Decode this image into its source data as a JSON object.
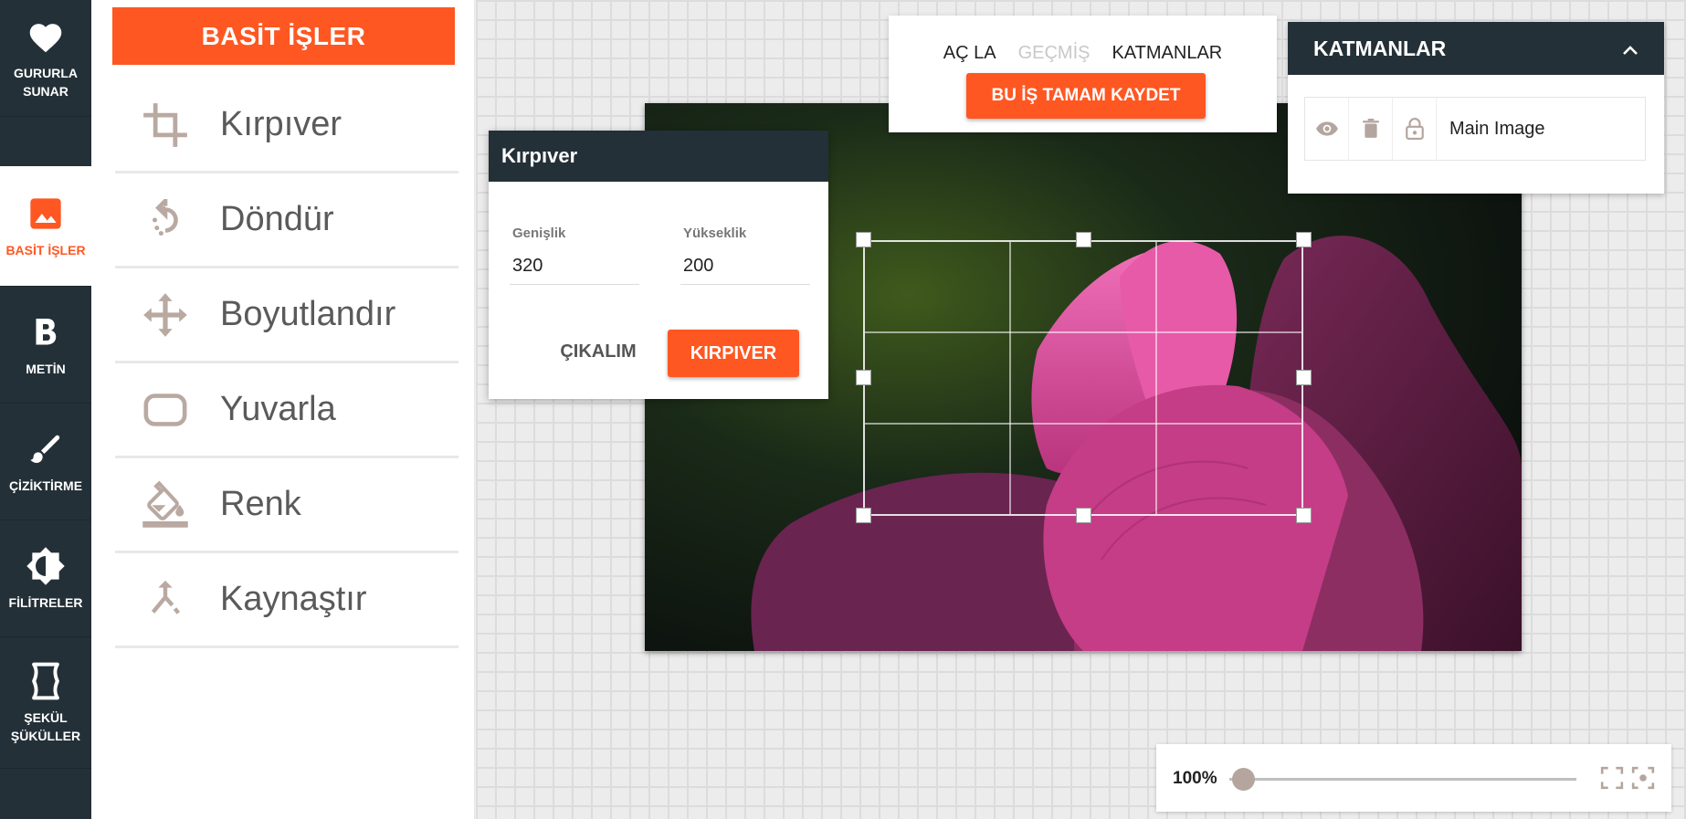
{
  "rail": {
    "items": [
      {
        "label_line1": "GURURLA",
        "label_line2": "SUNAR",
        "icon": "heart-icon"
      },
      {
        "label_line1": "BASİT İŞLER",
        "label_line2": "",
        "icon": "image-icon",
        "active": true
      },
      {
        "label_line1": "METİN",
        "label_line2": "",
        "icon": "bold-b-icon"
      },
      {
        "label_line1": "ÇİZİKTİRME",
        "label_line2": "",
        "icon": "brush-icon"
      },
      {
        "label_line1": "FİLİTRELER",
        "label_line2": "",
        "icon": "brightness-icon"
      },
      {
        "label_line1": "ŞEKÜL",
        "label_line2": "ŞÜKÜLLER",
        "icon": "shape-icon"
      }
    ]
  },
  "tools": {
    "header": "BASİT İŞLER",
    "items": [
      {
        "label": "Kırpıver",
        "icon": "crop-icon"
      },
      {
        "label": "Döndür",
        "icon": "rotate-icon"
      },
      {
        "label": "Boyutlandır",
        "icon": "resize-arrows-icon"
      },
      {
        "label": "Yuvarla",
        "icon": "rounded-rect-icon"
      },
      {
        "label": "Renk",
        "icon": "paint-bucket-icon"
      },
      {
        "label": "Kaynaştır",
        "icon": "merge-icon"
      }
    ]
  },
  "topmenu": {
    "tabs": [
      {
        "label": "AÇ LA",
        "disabled": false
      },
      {
        "label": "GEÇMİŞ",
        "disabled": true
      },
      {
        "label": "KATMANLAR",
        "disabled": false
      }
    ],
    "save_label": "BU İŞ TAMAM KAYDET"
  },
  "layers": {
    "title": "KATMANLAR",
    "row": {
      "name": "Main Image"
    }
  },
  "crop_dialog": {
    "title": "Kırpıver",
    "width_label": "Genişlik",
    "width_value": "320",
    "height_label": "Yükseklik",
    "height_value": "200",
    "cancel_label": "ÇIKALIM",
    "confirm_label": "KIRPIVER"
  },
  "zoom": {
    "value": "100%",
    "level": 0.04
  },
  "colors": {
    "accent": "#ff5722",
    "dark": "#243038",
    "icon_muted": "#b4a59e"
  }
}
